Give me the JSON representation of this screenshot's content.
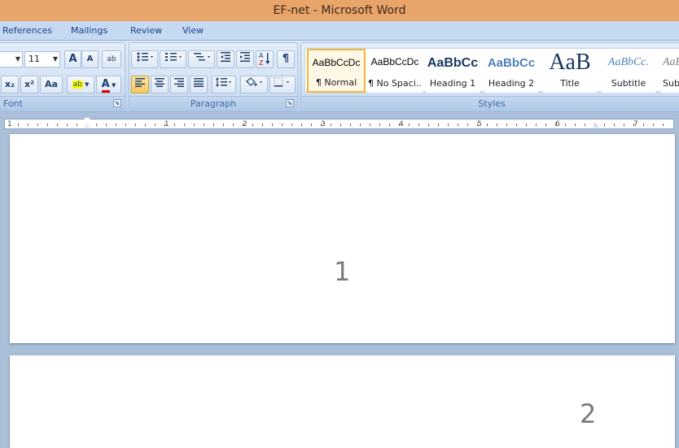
{
  "window": {
    "title": "EF-net - Microsoft Word"
  },
  "tabs": [
    "References",
    "Mailings",
    "Review",
    "View"
  ],
  "font_group": {
    "label": "Font",
    "font_name": "",
    "font_size": "11",
    "grow_font": "A",
    "shrink_font": "A",
    "clear_format": "ab",
    "subscript": "x₂",
    "superscript": "x²",
    "change_case": "Aa",
    "highlight": "ab",
    "font_color": "A"
  },
  "paragraph_group": {
    "label": "Paragraph",
    "show_hide": "¶"
  },
  "styles_group": {
    "label": "Styles",
    "items": [
      {
        "sample": "AaBbCcDc",
        "name": "¶ Normal"
      },
      {
        "sample": "AaBbCcDc",
        "name": "¶ No Spaci..."
      },
      {
        "sample": "AaBbCc",
        "name": "Heading 1"
      },
      {
        "sample": "AaBbCc",
        "name": "Heading 2"
      },
      {
        "sample": "AaB",
        "name": "Title"
      },
      {
        "sample": "AaBbCc.",
        "name": "Subtitle"
      },
      {
        "sample": "AaBl",
        "name": "Subt"
      }
    ]
  },
  "ruler": {
    "numbers": [
      "1",
      "1",
      "2",
      "3",
      "4",
      "5",
      "6",
      "7"
    ]
  },
  "pages": [
    {
      "number": "1"
    },
    {
      "number": "2"
    }
  ],
  "colors": {
    "titlebar": "#e9a46a",
    "ribbon": "#dfe9f5",
    "workspace": "#abbfd8",
    "selected_style": "#f1b83c"
  }
}
